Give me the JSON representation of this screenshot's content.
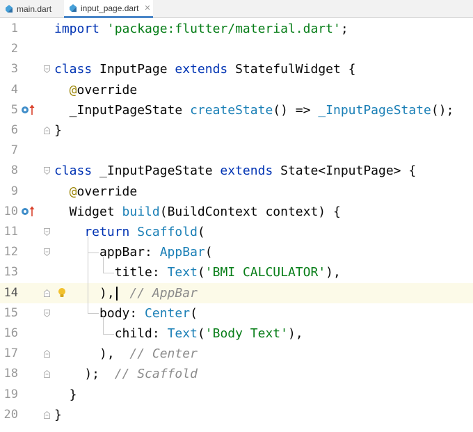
{
  "tabs": [
    {
      "label": "main.dart",
      "active": false
    },
    {
      "label": "input_page.dart",
      "active": true
    }
  ],
  "colors": {
    "keyword": "#0033b3",
    "string": "#067d17",
    "class_ref": "#1a7fb6",
    "annotation": "#9e880d",
    "comment": "#8c8c8c",
    "current_line": "#fcfae8"
  },
  "editor": {
    "current_line": 14,
    "line_numbers": [
      "1",
      "2",
      "3",
      "4",
      "5",
      "6",
      "7",
      "8",
      "9",
      "10",
      "11",
      "12",
      "13",
      "14",
      "15",
      "16",
      "17",
      "18",
      "19",
      "20"
    ],
    "lines": [
      [
        {
          "t": "import ",
          "c": "kw"
        },
        {
          "t": "'package:flutter/material.dart'",
          "c": "str"
        },
        {
          "t": ";",
          "c": ""
        }
      ],
      [],
      [
        {
          "t": "class ",
          "c": "kw"
        },
        {
          "t": "InputPage ",
          "c": ""
        },
        {
          "t": "extends ",
          "c": "kw"
        },
        {
          "t": "StatefulWidget {",
          "c": ""
        }
      ],
      [
        {
          "t": "  @",
          "c": "ann"
        },
        {
          "t": "override",
          "c": ""
        }
      ],
      [
        {
          "t": "  _InputPageState ",
          "c": ""
        },
        {
          "t": "createState",
          "c": "cls"
        },
        {
          "t": "() => ",
          "c": ""
        },
        {
          "t": "_InputPageState",
          "c": "cls"
        },
        {
          "t": "();",
          "c": ""
        }
      ],
      [
        {
          "t": "}",
          "c": ""
        }
      ],
      [],
      [
        {
          "t": "class ",
          "c": "kw"
        },
        {
          "t": "_InputPageState ",
          "c": ""
        },
        {
          "t": "extends ",
          "c": "kw"
        },
        {
          "t": "State<InputPage> {",
          "c": ""
        }
      ],
      [
        {
          "t": "  @",
          "c": "ann"
        },
        {
          "t": "override",
          "c": ""
        }
      ],
      [
        {
          "t": "  Widget ",
          "c": ""
        },
        {
          "t": "build",
          "c": "cls"
        },
        {
          "t": "(BuildContext context) {",
          "c": ""
        }
      ],
      [
        {
          "t": "    return ",
          "c": "kw"
        },
        {
          "t": "Scaffold",
          "c": "cls"
        },
        {
          "t": "(",
          "c": ""
        }
      ],
      [
        {
          "t": "      appBar: ",
          "c": ""
        },
        {
          "t": "AppBar",
          "c": "cls"
        },
        {
          "t": "(",
          "c": ""
        }
      ],
      [
        {
          "t": "        title: ",
          "c": ""
        },
        {
          "t": "Text",
          "c": "cls"
        },
        {
          "t": "(",
          "c": ""
        },
        {
          "t": "'BMI CALCULATOR'",
          "c": "str"
        },
        {
          "t": "),",
          "c": ""
        }
      ],
      [
        {
          "t": "      ),",
          "c": ""
        },
        {
          "t": "  // AppBar",
          "c": "cm"
        }
      ],
      [
        {
          "t": "      body: ",
          "c": ""
        },
        {
          "t": "Center",
          "c": "cls"
        },
        {
          "t": "(",
          "c": ""
        }
      ],
      [
        {
          "t": "        child: ",
          "c": ""
        },
        {
          "t": "Text",
          "c": "cls"
        },
        {
          "t": "(",
          "c": ""
        },
        {
          "t": "'Body Text'",
          "c": "str"
        },
        {
          "t": "),",
          "c": ""
        }
      ],
      [
        {
          "t": "      ),  ",
          "c": ""
        },
        {
          "t": "// Center",
          "c": "cm"
        }
      ],
      [
        {
          "t": "    );  ",
          "c": ""
        },
        {
          "t": "// Scaffold",
          "c": "cm"
        }
      ],
      [
        {
          "t": "  }",
          "c": ""
        }
      ],
      [
        {
          "t": "}",
          "c": ""
        }
      ]
    ]
  }
}
